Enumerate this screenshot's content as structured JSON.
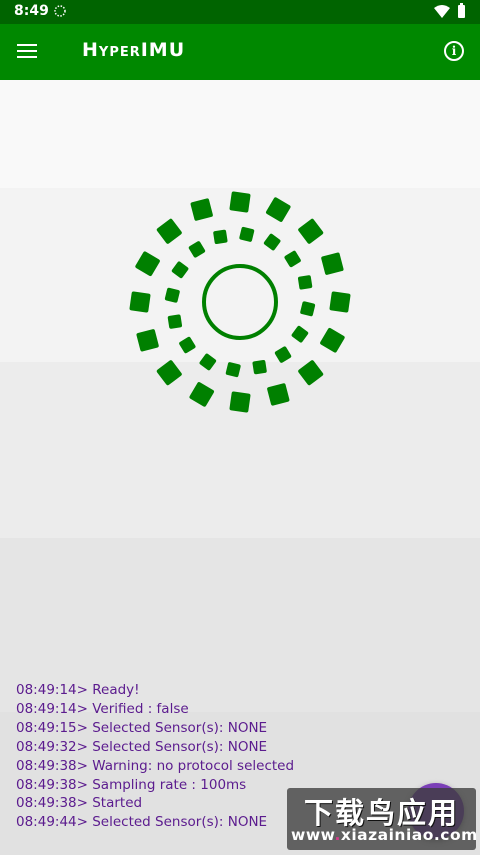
{
  "status_bar": {
    "time": "8:49",
    "icons": [
      "sync-icon",
      "wifi-icon",
      "battery-icon"
    ]
  },
  "app_bar": {
    "title": "HyperIMU",
    "menu_icon": "menu-icon",
    "info_icon": "info-icon",
    "info_glyph": "i",
    "color": "#008800",
    "status_color": "#006400"
  },
  "spinner": {
    "color": "#008000",
    "icon": "sensor-radar-icon"
  },
  "log": [
    "08:49:14> Ready!",
    "08:49:14> Verified : false",
    "08:49:15> Selected Sensor(s): NONE",
    "08:49:32> Selected Sensor(s): NONE",
    "08:49:38> Warning: no protocol selected",
    "08:49:38> Sampling rate : 100ms",
    "08:49:38> Started",
    "08:49:44> Selected Sensor(s): NONE"
  ],
  "fab": {
    "color": "#7b3fb7"
  },
  "watermark": {
    "cn": "下载鸟应用",
    "site_prefix": "www",
    "site_dot": ".",
    "site_rest": "xiazainiao.com"
  }
}
